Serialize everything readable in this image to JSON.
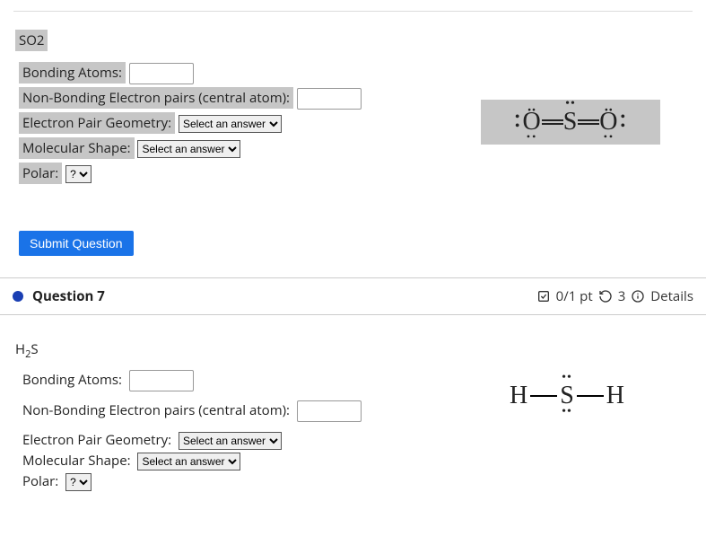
{
  "q6": {
    "formula_html": "SO2",
    "bonding_atoms_label": "Bonding Atoms:",
    "nonbonding_label": "Non-Bonding Electron pairs (central atom):",
    "epg_label": "Electron Pair Geometry:",
    "epg_placeholder": "Select an answer",
    "shape_label": "Molecular Shape:",
    "shape_placeholder": "Select an answer",
    "polar_label": "Polar:",
    "polar_placeholder": "?",
    "submit_label": "Submit Question"
  },
  "q7": {
    "header_title": "Question 7",
    "points": "0/1 pt",
    "attempts": "3",
    "details_label": "Details",
    "formula_base": "H",
    "formula_sub": "2",
    "formula_suffix": "S",
    "bonding_atoms_label": "Bonding Atoms:",
    "nonbonding_label": "Non-Bonding Electron pairs (central atom):",
    "epg_label": "Electron Pair Geometry:",
    "epg_placeholder": "Select an answer",
    "shape_label": "Molecular Shape:",
    "shape_placeholder": "Select an answer",
    "polar_label": "Polar:",
    "polar_placeholder": "?"
  }
}
